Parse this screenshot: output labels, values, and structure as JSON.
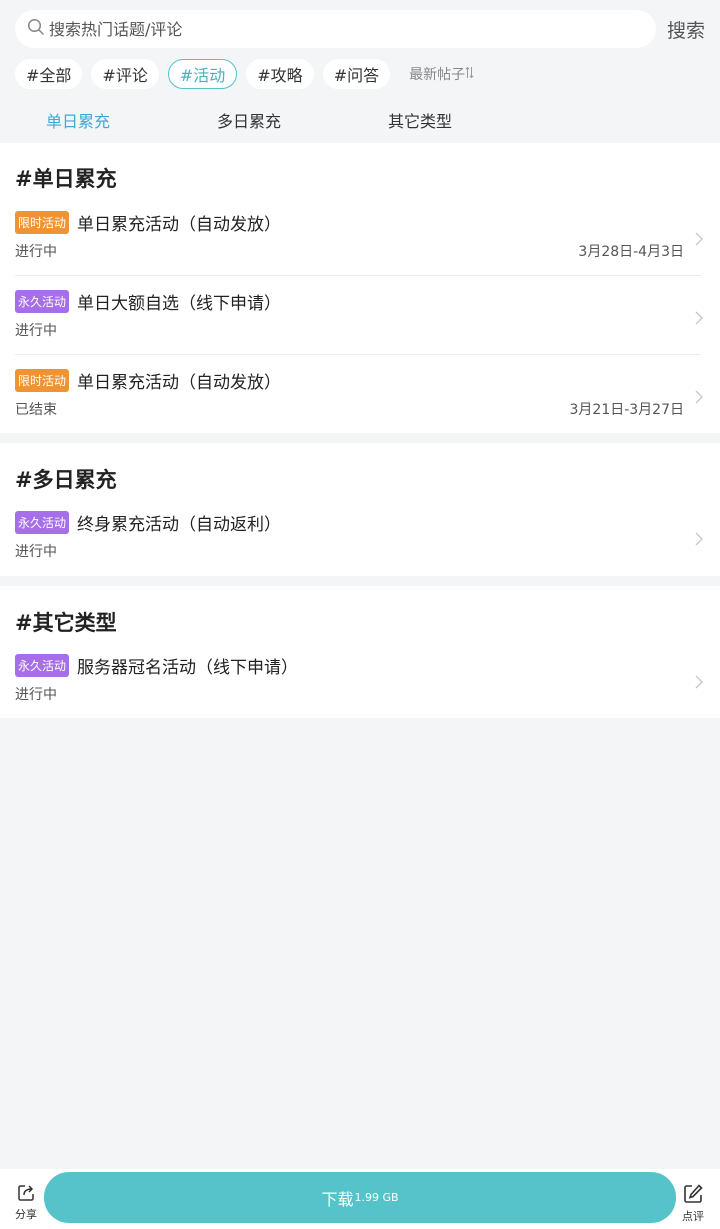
{
  "search": {
    "placeholder": "搜索热门话题/评论",
    "button": "搜索"
  },
  "tags": [
    {
      "label": "#全部"
    },
    {
      "label": "#评论"
    },
    {
      "label": "#活动",
      "active": true
    },
    {
      "label": "#攻略"
    },
    {
      "label": "#问答"
    }
  ],
  "sort": {
    "label": "最新帖子"
  },
  "tabs": [
    {
      "label": "单日累充",
      "active": true
    },
    {
      "label": "多日累充"
    },
    {
      "label": "其它类型"
    }
  ],
  "sections": [
    {
      "title": "#单日累充",
      "items": [
        {
          "badge": "限时活动",
          "title": "单日累充活动（自动发放）",
          "status": "进行中",
          "date": "3月28日-4月3日"
        },
        {
          "badge": "永久活动",
          "title": "单日大额自选（线下申请）",
          "status": "进行中",
          "date": ""
        },
        {
          "badge": "限时活动",
          "title": "单日累充活动（自动发放）",
          "status": "已结束",
          "date": "3月21日-3月27日"
        }
      ]
    },
    {
      "title": "#多日累充",
      "items": [
        {
          "badge": "永久活动",
          "title": "终身累充活动（自动返利）",
          "status": "进行中",
          "date": ""
        }
      ]
    },
    {
      "title": "#其它类型",
      "items": [
        {
          "badge": "永久活动",
          "title": "服务器冠名活动（线下申请）",
          "status": "进行中",
          "date": ""
        }
      ]
    }
  ],
  "bottom": {
    "share": "分享",
    "download": "下载",
    "size": "1.99 GB",
    "review": "点评"
  },
  "colors": {
    "accent": "#56c3cb",
    "tab_active": "#3fa9d6",
    "badge_limited": "#f09433",
    "badge_permanent": "#a66ee8"
  },
  "icons": {
    "search": "search-icon",
    "sort": "sort-arrows-icon",
    "chevron": "chevron-right-icon",
    "share": "share-icon",
    "review": "edit-icon"
  }
}
